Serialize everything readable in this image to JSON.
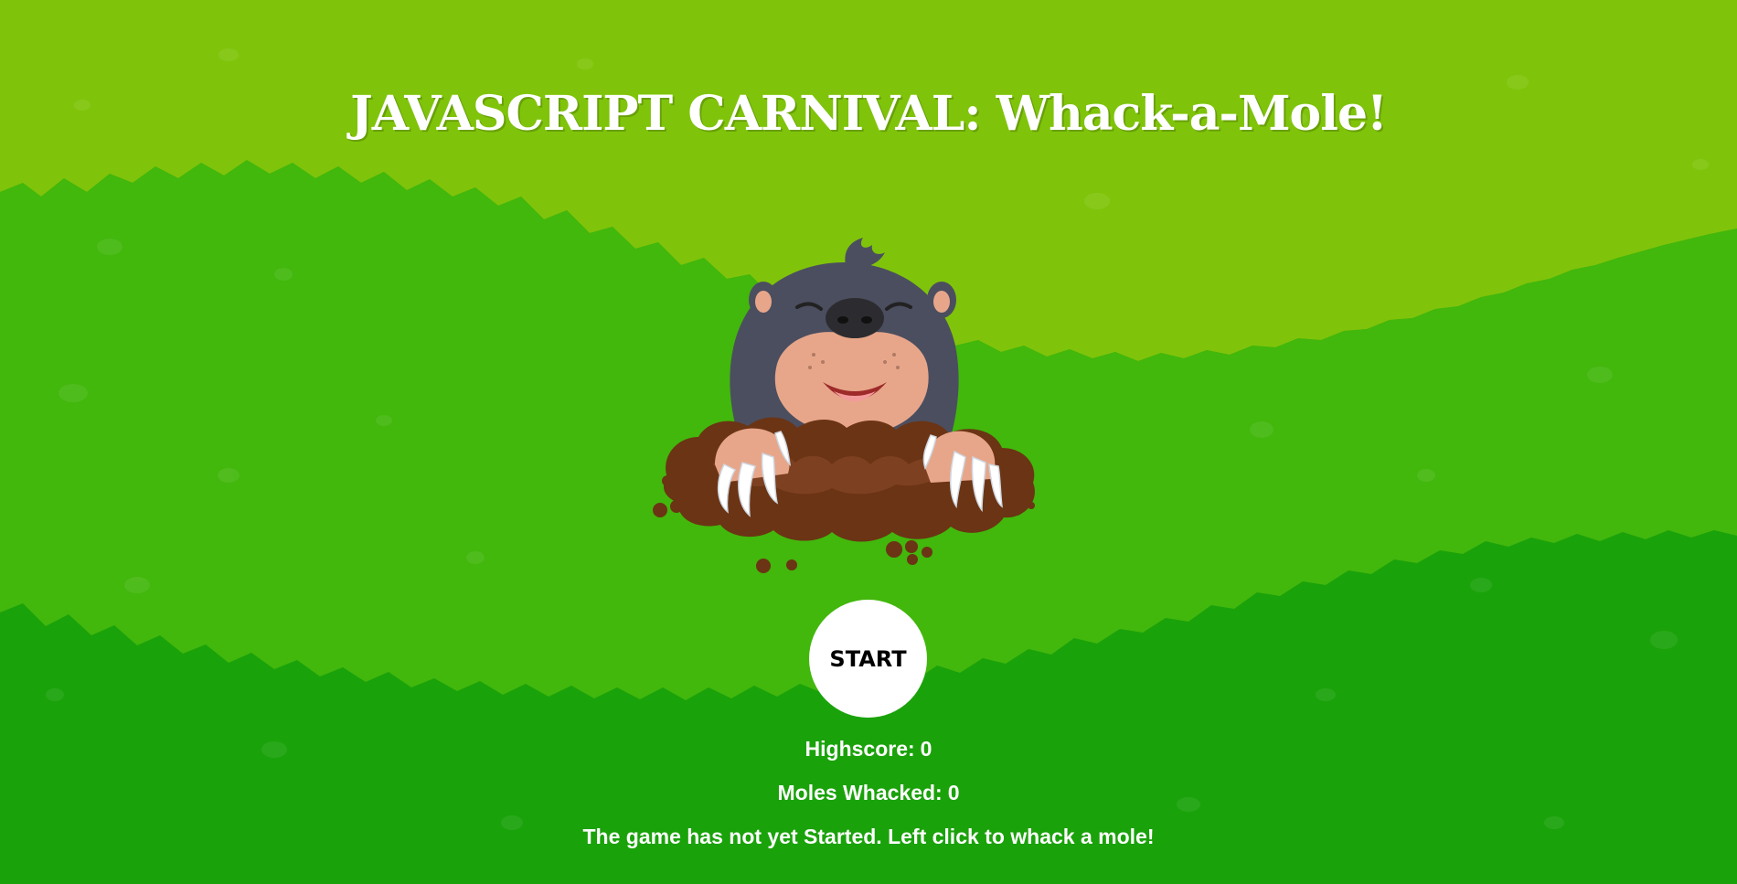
{
  "title": "JAVASCRIPT CARNIVAL: Whack-a-Mole!",
  "start_button": "START",
  "stats": {
    "highscore_label": "Highscore:",
    "highscore_value": "0",
    "whacked_label": "Moles Whacked:",
    "whacked_value": "0"
  },
  "status_message": "The game has not yet Started. Left click to whack a mole!",
  "mole_icon": "mole-in-hole",
  "colors": {
    "grass_light": "#7fc40a",
    "grass_mid": "#42b70c",
    "grass_dark": "#1aa20a",
    "text": "#ffffff",
    "button_bg": "#ffffff",
    "mole_body": "#4b4e5f",
    "mole_face": "#e7a68a",
    "dirt": "#6b3414"
  }
}
